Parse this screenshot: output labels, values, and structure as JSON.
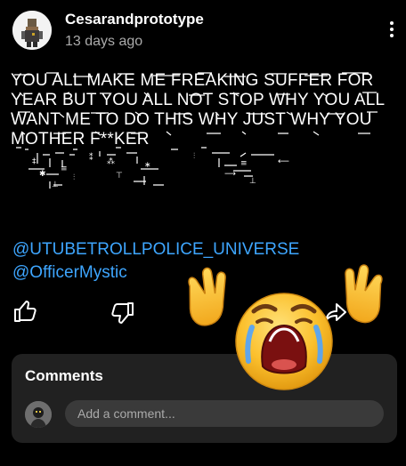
{
  "post": {
    "username": "Cesarandprototype",
    "timestamp": "13 days ago",
    "text": "YOU ALL MAKE ME FREAKING SUFFER FOR YEAR BUT YOU ALL NOT STOP WHY YOU ALL WANT ME TO DO THIS WHY JUST WHY YOU MOTHER F**KER",
    "mentions": [
      "@UTUBETROLLPOLICE_UNIVERSE",
      "@OfficerMystic"
    ]
  },
  "icons": {
    "more": "more-vertical-icon",
    "like": "thumbs-up-icon",
    "dislike": "thumbs-down-icon",
    "share": "share-icon",
    "sticker": "crying-emoji-sticker"
  },
  "comments": {
    "title": "Comments",
    "placeholder": "Add a comment..."
  },
  "colors": {
    "background": "#000000",
    "link": "#3ea6ff",
    "panel": "#212121",
    "input": "#3a3a3a"
  }
}
